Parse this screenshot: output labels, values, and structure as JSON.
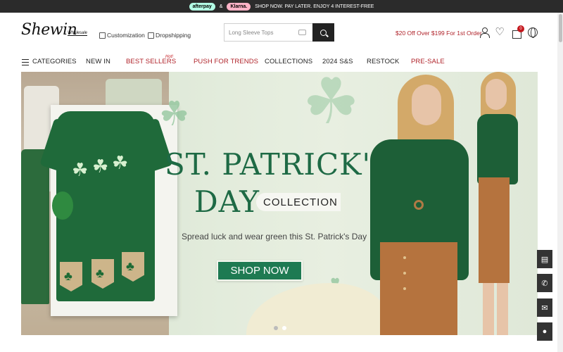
{
  "promo": {
    "afterpay": "afterpay",
    "and": "&",
    "klarna": "Klarna.",
    "text": "SHOP NOW. PAY LATER. ENJOY 4 INTEREST-FREE"
  },
  "header": {
    "logo": "Shewin",
    "logo_sub": "Wholesale",
    "customization": "Customization",
    "dropshipping": "Dropshipping",
    "search_placeholder": "Long Sleeve Tops",
    "offer": "$20 Off Over $199 For 1st Order",
    "cart_count": "0"
  },
  "nav": {
    "categories": "CATEGORIES",
    "new_in": "NEW IN",
    "best_sellers": "BEST SELLERS",
    "hot": "Hot!",
    "push_for_trends": "PUSH FOR TRENDS",
    "collections": "COLLECTIONS",
    "ss2024": "2024 S&S",
    "restock": "RESTOCK",
    "pre_sale": "PRE-SALE"
  },
  "banner": {
    "title_line1": "ST. PATRICK'S",
    "title_line2": "DAY",
    "collection": "COLLECTION",
    "subtitle": "Spread luck and wear green this St. Patrick's Day",
    "cta": "SHOP NOW",
    "slides": 2,
    "active_slide": 2
  },
  "colors": {
    "brand_green": "#1e6a45",
    "accent_red": "#b0232a",
    "promo_bg": "#2b2b2b"
  }
}
